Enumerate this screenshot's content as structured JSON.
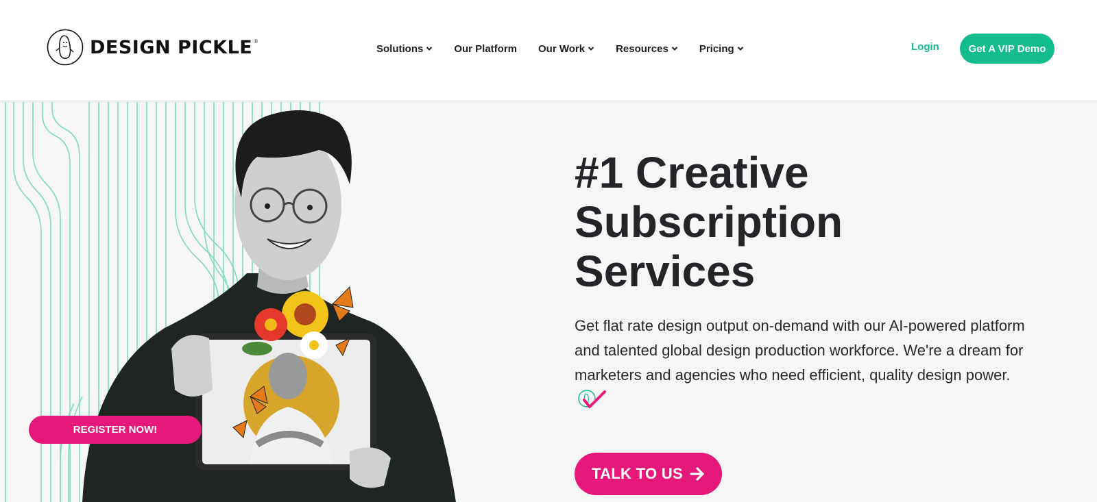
{
  "brand": {
    "name": "DESIGN PICKLE",
    "registered_mark": "®",
    "logo_icon": "pickle-logo-icon"
  },
  "nav": {
    "items": [
      {
        "label": "Solutions",
        "has_dropdown": true
      },
      {
        "label": "Our Platform",
        "has_dropdown": false
      },
      {
        "label": "Our Work",
        "has_dropdown": true
      },
      {
        "label": "Resources",
        "has_dropdown": true
      },
      {
        "label": "Pricing",
        "has_dropdown": true
      }
    ],
    "login_label": "Login",
    "cta_label": "Get A VIP Demo"
  },
  "hero": {
    "headline_lines": [
      "#1 Creative",
      "Subscription",
      "Services"
    ],
    "description": "Get flat rate design output on-demand with our AI-powered platform and talented global design production workforce. We're a dream for marketers and agencies who need efficient, quality design power.",
    "check_icon": "pickle-check-icon",
    "cta_label": "TALK TO US",
    "cta_icon": "arrow-right-icon",
    "register_label": "REGISTER NOW!"
  },
  "colors": {
    "accent_green": "#13bc8d",
    "accent_pink": "#e6197a",
    "hero_bg": "#f6f6f6",
    "line_pattern": "#7fdcc0"
  }
}
